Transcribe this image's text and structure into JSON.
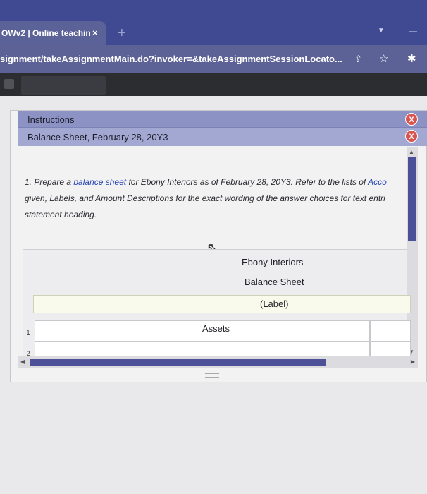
{
  "browser": {
    "tab_title": "OWv2 | Online teachin",
    "tab_close": "×",
    "new_tab": "+",
    "url": "signment/takeAssignmentMain.do?invoker=&takeAssignmentSessionLocato...",
    "icons": [
      "share-icon",
      "star-icon",
      "extension-icon"
    ]
  },
  "panel": {
    "instructions_label": "Instructions",
    "sheet_title": "Balance Sheet, February 28, 20Y3",
    "close_glyph": "X",
    "question": {
      "part1": "1. Prepare a ",
      "link_text": "balance sheet",
      "part2": " for Ebony Interiors as of February 28, 20Y3. Refer to the lists of ",
      "link2_text": "Acco",
      "line2": "given, Labels, and Amount Descriptions for the exact wording of the answer choices for text entri",
      "line3": "statement heading."
    },
    "statement": {
      "company": "Ebony Interiors",
      "statement_type": "Balance Sheet",
      "label_placeholder": "(Label)",
      "rows": [
        {
          "num": "1",
          "text": "Assets"
        },
        {
          "num": "2",
          "text": ""
        }
      ]
    }
  }
}
